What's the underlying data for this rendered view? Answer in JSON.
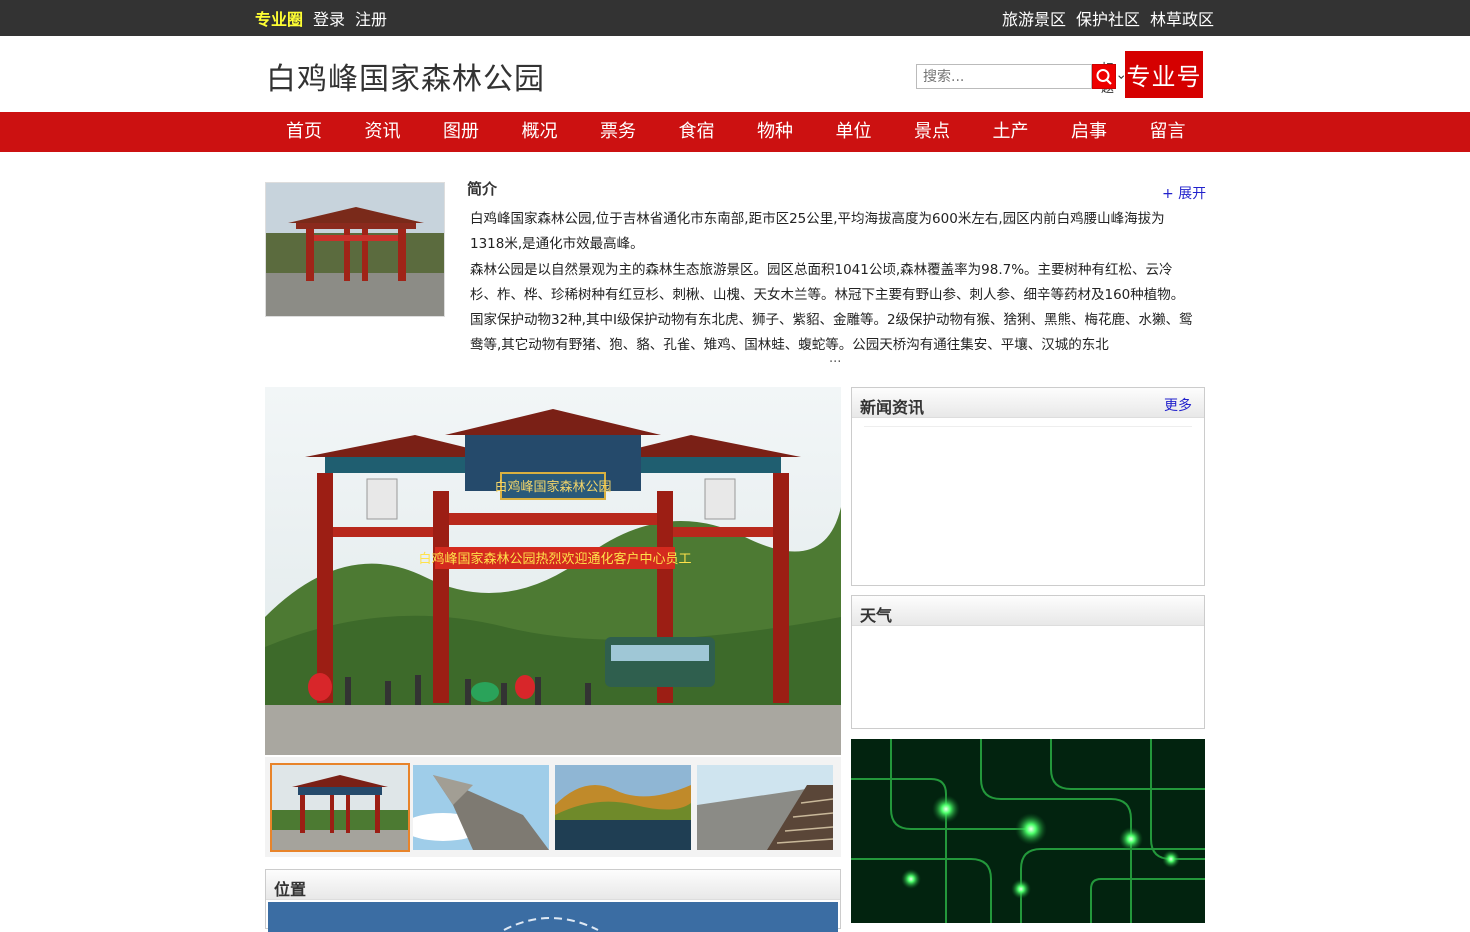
{
  "topbar": {
    "brand": "专业圈",
    "login": "登录",
    "register": "注册",
    "right_links": [
      "旅游景区",
      "保护社区",
      "林草政区"
    ]
  },
  "header": {
    "title": "白鸡峰国家森林公园",
    "search_placeholder": "搜索...",
    "search_scope": "标题",
    "badge": "专业号"
  },
  "nav": [
    "首页",
    "资讯",
    "图册",
    "概况",
    "票务",
    "食宿",
    "物种",
    "单位",
    "景点",
    "土产",
    "启事",
    "留言"
  ],
  "intro": {
    "title": "简介",
    "expand": "+ 展开",
    "para1": "白鸡峰国家森林公园,位于吉林省通化市东南部,距市区25公里,平均海拔高度为600米左右,园区内前白鸡腰山峰海拔为1318米,是通化市效最高峰。",
    "para2": "森林公园是以自然景观为主的森林生态旅游景区。园区总面积1041公顷,森林覆盖率为98.7%。主要树种有红松、云冷杉、柞、桦、珍稀树种有红豆杉、刺楸、山槐、天女木兰等。林冠下主要有野山参、刺人参、细辛等药材及160种植物。国家保护动物32种,其中Ⅰ级保护动物有东北虎、狮子、紫貂、金雕等。2级保护动物有猴、猞猁、黑熊、梅花鹿、水獭、鸳鸯等,其它动物有野猪、狍、貉、孔雀、雉鸡、国林蛙、蝮蛇等。公园天桥沟有通往集安、平壤、汉城的东北",
    "ellipsis": "..."
  },
  "gallery": {
    "main_caption": "白鸡峰国家森林公园热烈欢迎通化客户中心员工",
    "gate_plaque": "白鸡峰国家森林公园",
    "thumbs": [
      "gate",
      "rock",
      "lake",
      "stairs"
    ]
  },
  "news": {
    "title": "新闻资讯",
    "more": "更多"
  },
  "weather": {
    "title": "天气"
  },
  "location": {
    "title": "位置"
  },
  "colors": {
    "nav_red": "#cc1111",
    "brand_yellow": "#ffff33",
    "link_blue": "#2222cc"
  }
}
